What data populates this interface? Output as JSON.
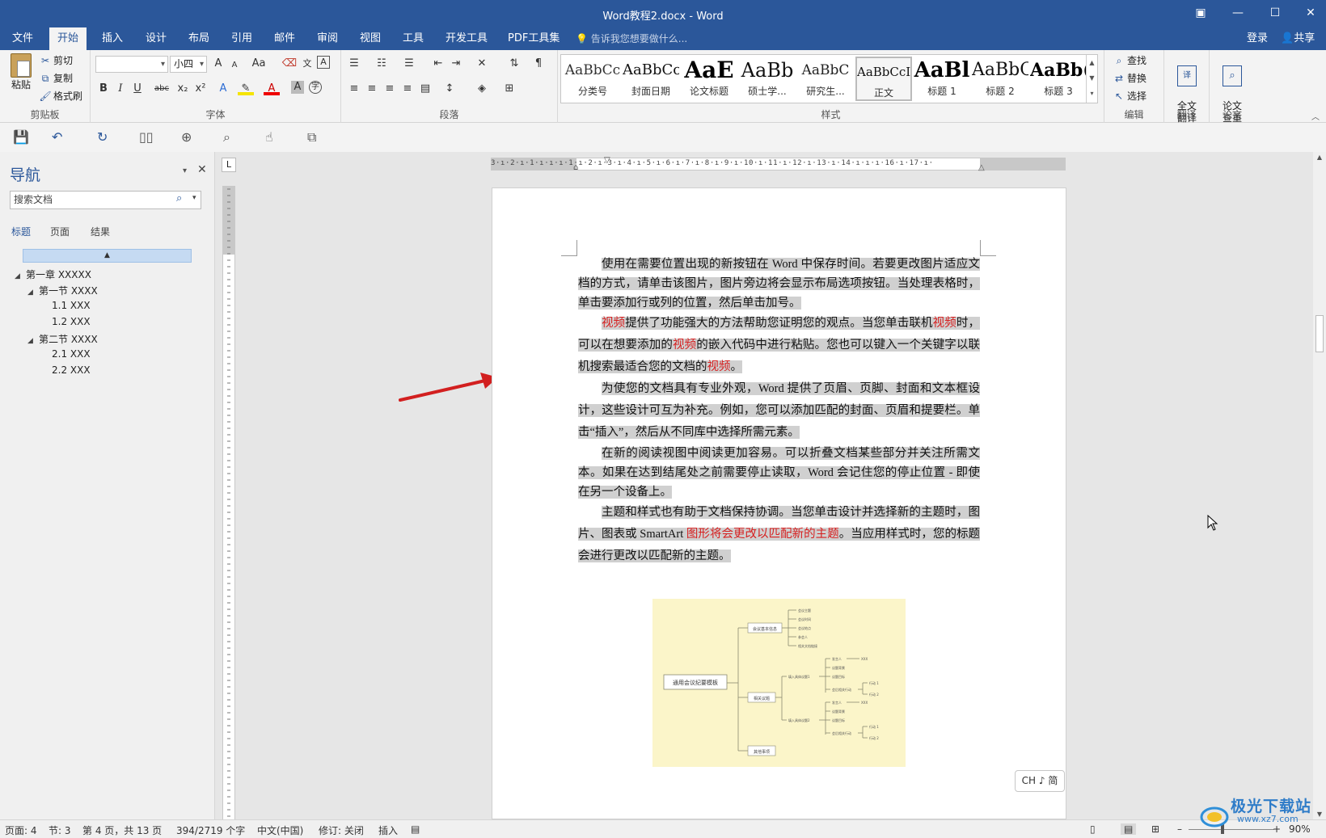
{
  "window": {
    "title": "Word教程2.docx - Word"
  },
  "tabs": [
    "文件",
    "开始",
    "插入",
    "设计",
    "布局",
    "引用",
    "邮件",
    "审阅",
    "视图",
    "工具",
    "开发工具",
    "PDF工具集"
  ],
  "tellme": "告诉我您想要做什么...",
  "account": {
    "login": "登录",
    "share": "共享"
  },
  "clipboard": {
    "paste": "粘贴",
    "cut": "剪切",
    "copy": "复制",
    "format_painter": "格式刷",
    "label": "剪贴板"
  },
  "font": {
    "name": "",
    "size": "小四",
    "label": "字体",
    "grow": "A",
    "shrink": "A",
    "case": "Aa",
    "bold": "B",
    "italic": "I",
    "underline": "U",
    "strike": "abc",
    "sub": "x₂",
    "sup": "x²"
  },
  "paragraph": {
    "label": "段落"
  },
  "styles": {
    "label": "样式",
    "items": [
      {
        "sample": "AaBbCc",
        "name": "分类号"
      },
      {
        "sample": "AaBbCc",
        "name": "封面日期"
      },
      {
        "sample": "AaE",
        "name": "论文标题"
      },
      {
        "sample": "AaBb",
        "name": "硕士学..."
      },
      {
        "sample": "AaBbC",
        "name": "研究生..."
      },
      {
        "sample": "AaBbCcI",
        "name": "正文"
      },
      {
        "sample": "AaBl",
        "name": "标题 1"
      },
      {
        "sample": "AaBbC",
        "name": "标题 2"
      },
      {
        "sample": "AaBb(",
        "name": "标题 3"
      }
    ]
  },
  "editing": {
    "find": "查找",
    "replace": "替换",
    "select": "选择",
    "label": "编辑"
  },
  "translate": {
    "button": "全文\n翻译",
    "label": "翻译"
  },
  "paper": {
    "button": "论文\n查重",
    "label": "论文"
  },
  "nav": {
    "title": "导航",
    "search_placeholder": "搜索文档",
    "tabs": [
      "标题",
      "页面",
      "结果"
    ],
    "tree": [
      {
        "text": "第一章 XXXXX",
        "level": 0,
        "expander": true
      },
      {
        "text": "第一节 XXXX",
        "level": 1,
        "expander": true
      },
      {
        "text": "1.1 XXX",
        "level": 2,
        "expander": false
      },
      {
        "text": "1.2 XXX",
        "level": 2,
        "expander": false
      },
      {
        "text": "第二节 XXXX",
        "level": 1,
        "expander": true
      },
      {
        "text": "2.1 XXX",
        "level": 2,
        "expander": false
      },
      {
        "text": "2.2 XXX",
        "level": 2,
        "expander": false
      }
    ]
  },
  "ruler": "3·ı·2·ı·1·ı·ı·ı·1·ı·2·ı·3·ı·4·ı·5·ı·6·ı·7·ı·8·ı·9·ı·10·ı·11·ı·12·ı·13·ı·14·ı·ı·ı·16·ı·17·ı·",
  "document": {
    "p1": "使用在需要位置出现的新按钮在 Word 中保存时间。若要更改图片适应文档的方式，请单击该图片，图片旁边将会显示布局选项按钮。当处理表格时，单击要添加行或列的位置，然后单击加号。",
    "p2a": "视频",
    "p2b": "提供了功能强大的方法帮助您证明您的观点。当您单击联机",
    "p2c": "视频",
    "p2d": "时，可以在想要添加的",
    "p2e": "视频",
    "p2f": "的嵌入代码中进行粘贴。您也可以键入一个关键字以联机搜索最适合您的文档的",
    "p2g": "视频",
    "p2h": "。",
    "p3": "为使您的文档具有专业外观，Word 提供了页眉、页脚、封面和文本框设计，这些设计可互为补充。例如，您可以添加匹配的封面、页眉和提要栏。单击“插入”，然后从不同库中选择所需元素。",
    "p4": "在新的阅读视图中阅读更加容易。可以折叠文档某些部分并关注所需文本。如果在达到结尾处之前需要停止读取，Word 会记住您的停止位置 - 即使在另一个设备上。",
    "p5a": "主题和样式也有助于文档保持协调。当您单击设计并选择新的主题时，图片、图表或 SmartArt ",
    "p5b": "图形将会更改以匹配新的主题",
    "p5c": "。当应用样式时，您的标题会进行更改以匹配新的主题。"
  },
  "mindmap": {
    "root": "通用会议纪要模板",
    "branches": [
      "会议基本信息",
      "相关议题",
      "其他事项"
    ],
    "info_items": [
      "会议主题",
      "会议时间",
      "会议地点",
      "参会人",
      "相关文档链接"
    ],
    "topics": [
      "填入具体议题1",
      "填入具体议题2"
    ],
    "topic_details": [
      "发言人",
      "议题背景",
      "议题目标",
      "会后相关行动"
    ],
    "person": "XXX",
    "actions": [
      "行动 1",
      "行动 2"
    ]
  },
  "ime": "CH ♪ 简",
  "status": {
    "page": "页面: 4",
    "section": "节: 3",
    "pages": "第 4 页，共 13 页",
    "words": "394/2719 个字",
    "lang": "中文(中国)",
    "track": "修订: 关闭",
    "insert": "插入",
    "zoom": "90%"
  },
  "watermark": {
    "text": "极光下载站",
    "url": "www.xz7.com"
  },
  "colors": {
    "accent": "#2b579a",
    "highlight": "#d0d0d0",
    "red_text": "#d62020",
    "arrow": "#d21f1f"
  }
}
